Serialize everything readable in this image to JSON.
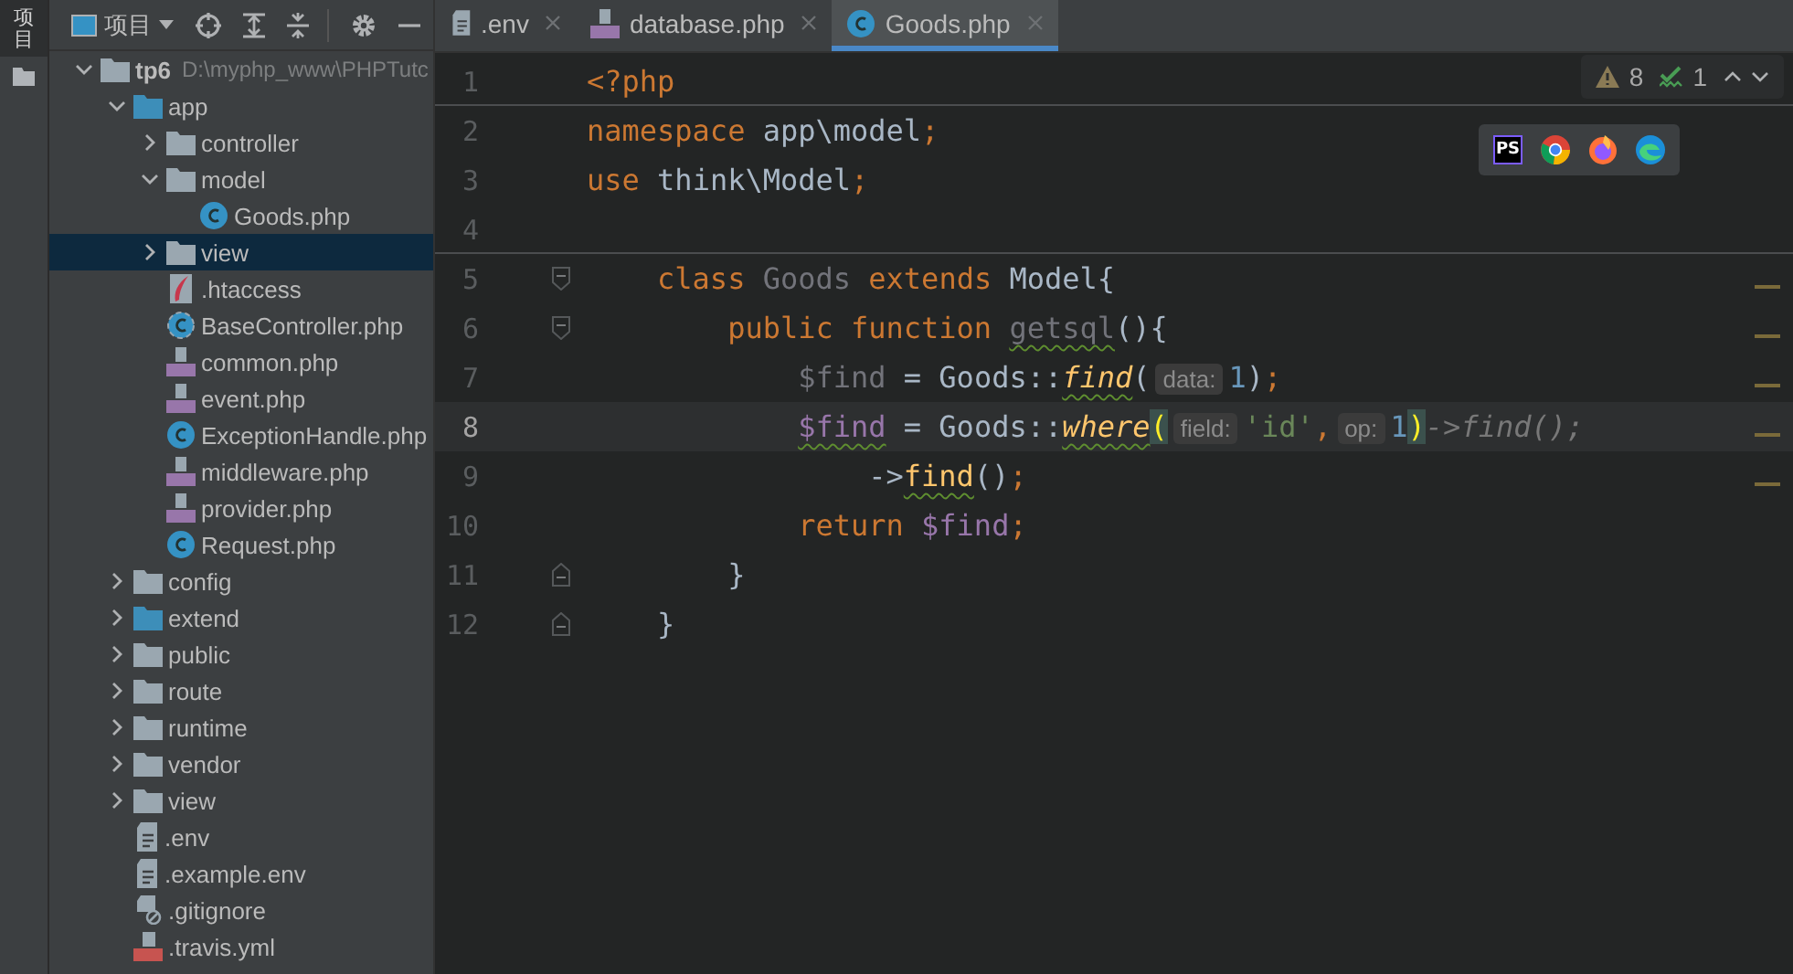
{
  "side_bar": {
    "tool_label": "项目"
  },
  "project_toolbar": {
    "title": "项目"
  },
  "tree": [
    {
      "label": "tp6",
      "path": "D:\\myphp_www\\PHPTutc",
      "kind": "folder",
      "expanded": true,
      "selected": false,
      "children": [
        {
          "label": "app",
          "kind": "source",
          "expanded": true,
          "selected": false,
          "children": [
            {
              "label": "controller",
              "kind": "folder",
              "expanded": false,
              "selected": false
            },
            {
              "label": "model",
              "kind": "folder",
              "expanded": true,
              "selected": false,
              "children": [
                {
                  "label": "Goods.php",
                  "kind": "class",
                  "selected": false
                }
              ]
            },
            {
              "label": "view",
              "kind": "folder",
              "expanded": false,
              "selected": true
            },
            {
              "label": ".htaccess",
              "kind": "htaccess",
              "selected": false
            },
            {
              "label": "BaseController.php",
              "kind": "abstract",
              "selected": false
            },
            {
              "label": "common.php",
              "kind": "php",
              "selected": false
            },
            {
              "label": "event.php",
              "kind": "php",
              "selected": false
            },
            {
              "label": "ExceptionHandle.php",
              "kind": "class",
              "selected": false
            },
            {
              "label": "middleware.php",
              "kind": "php",
              "selected": false
            },
            {
              "label": "provider.php",
              "kind": "php",
              "selected": false
            },
            {
              "label": "Request.php",
              "kind": "class",
              "selected": false
            }
          ]
        },
        {
          "label": "config",
          "kind": "folder",
          "expanded": false,
          "selected": false
        },
        {
          "label": "extend",
          "kind": "source",
          "expanded": false,
          "selected": false
        },
        {
          "label": "public",
          "kind": "folder",
          "expanded": false,
          "selected": false
        },
        {
          "label": "route",
          "kind": "folder",
          "expanded": false,
          "selected": false
        },
        {
          "label": "runtime",
          "kind": "folder",
          "expanded": false,
          "selected": false
        },
        {
          "label": "vendor",
          "kind": "folder",
          "expanded": false,
          "selected": false
        },
        {
          "label": "view",
          "kind": "folder",
          "expanded": false,
          "selected": false
        },
        {
          "label": ".env",
          "kind": "text",
          "selected": false
        },
        {
          "label": ".example.env",
          "kind": "text",
          "selected": false
        },
        {
          "label": ".gitignore",
          "kind": "ignore",
          "selected": false
        },
        {
          "label": ".travis.yml",
          "kind": "yaml",
          "selected": false
        }
      ]
    }
  ],
  "tabs": [
    {
      "label": ".env",
      "kind": "text",
      "selected": false
    },
    {
      "label": "database.php",
      "kind": "php",
      "selected": false
    },
    {
      "label": "Goods.php",
      "kind": "class",
      "selected": true
    }
  ],
  "inspections": {
    "warnings": "8",
    "typos": "1"
  },
  "browsers": [
    {
      "kind": "phpstorm",
      "label": "PS"
    },
    {
      "kind": "chrome"
    },
    {
      "kind": "firefox"
    },
    {
      "kind": "edge"
    }
  ],
  "lines": [
    {
      "number": "1",
      "tokens": [
        {
          "text": "<?php",
          "kind": "kw"
        }
      ]
    },
    {
      "number": "2",
      "separator_above": true,
      "tokens": [
        {
          "text": "namespace",
          "kind": "kw"
        },
        {
          "text": " app\\model",
          "kind": "plain"
        },
        {
          "text": ";",
          "kind": "kw"
        }
      ]
    },
    {
      "number": "3",
      "tokens": [
        {
          "text": "use",
          "kind": "kw"
        },
        {
          "text": " think\\Model",
          "kind": "plain"
        },
        {
          "text": ";",
          "kind": "kw"
        }
      ]
    },
    {
      "number": "4"
    },
    {
      "number": "5",
      "separator_above": true,
      "fold_start": true,
      "marker": true,
      "tokens": [
        {
          "text": "    class",
          "kind": "kw"
        },
        {
          "text": " Goods",
          "kind": "dim"
        },
        {
          "text": " extends",
          "kind": "kw"
        },
        {
          "text": " Model{",
          "kind": "plain"
        }
      ]
    },
    {
      "number": "6",
      "fold_start": true,
      "marker": true,
      "tokens": [
        {
          "text": "        public function ",
          "kind": "kw"
        },
        {
          "text": "getsql",
          "kind": "dim",
          "warned": true
        },
        {
          "text": "(){",
          "kind": "plain"
        }
      ]
    },
    {
      "number": "7",
      "marker": true,
      "tokens": [
        {
          "text": "            $find",
          "kind": "dim"
        },
        {
          "text": " = Goods::",
          "kind": "plain"
        },
        {
          "text": "find",
          "kind": "call",
          "warned": true
        },
        {
          "text": "(",
          "kind": "plain"
        },
        {
          "text": "data:",
          "kind": "hint"
        },
        {
          "text": "1",
          "kind": "num"
        },
        {
          "text": ")",
          "kind": "plain"
        },
        {
          "text": ";",
          "kind": "kw"
        }
      ]
    },
    {
      "number": "8",
      "current": true,
      "marker": true,
      "tokens": [
        {
          "text": "            $find",
          "kind": "var",
          "warned": true
        },
        {
          "text": " = Goods::",
          "kind": "plain"
        },
        {
          "text": "where",
          "kind": "call",
          "warned": true
        },
        {
          "text": "(",
          "kind": "match"
        },
        {
          "text": "field:",
          "kind": "hint"
        },
        {
          "text": "'id'",
          "kind": "str"
        },
        {
          "text": ",",
          "kind": "kw"
        },
        {
          "text": "op:",
          "kind": "hint"
        },
        {
          "text": "1",
          "kind": "num"
        },
        {
          "text": ")",
          "kind": "match"
        },
        {
          "text": "->find();",
          "kind": "ghost"
        }
      ]
    },
    {
      "number": "9",
      "marker": true,
      "tokens": [
        {
          "text": "                ->",
          "kind": "plain"
        },
        {
          "text": "find",
          "kind": "fn",
          "warned": true
        },
        {
          "text": "()",
          "kind": "plain"
        },
        {
          "text": ";",
          "kind": "kw"
        }
      ]
    },
    {
      "number": "10",
      "tokens": [
        {
          "text": "            return",
          "kind": "kw"
        },
        {
          "text": " $find",
          "kind": "var"
        },
        {
          "text": ";",
          "kind": "kw"
        }
      ]
    },
    {
      "number": "11",
      "fold_end": true,
      "tokens": [
        {
          "text": "        }",
          "kind": "plain"
        }
      ]
    },
    {
      "number": "12",
      "fold_end": true,
      "tokens": [
        {
          "text": "    }",
          "kind": "plain"
        }
      ]
    }
  ]
}
